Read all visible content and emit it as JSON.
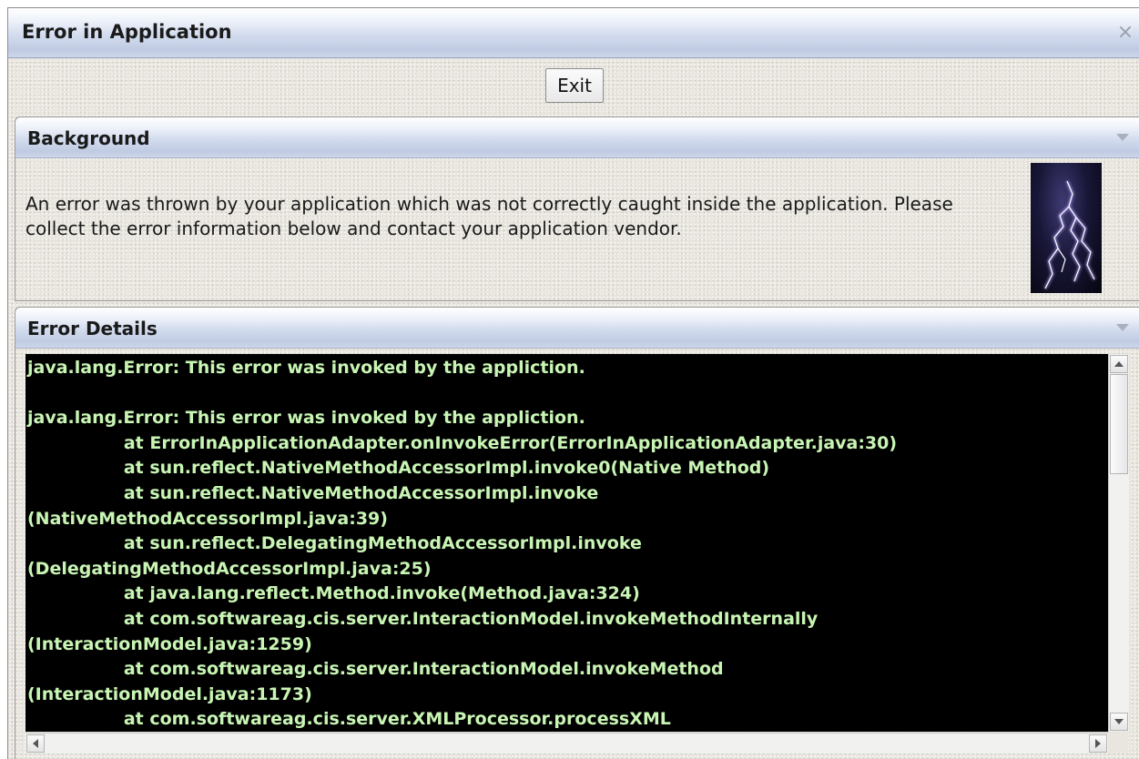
{
  "window": {
    "title": "Error in Application",
    "close_glyph": "×"
  },
  "exit_button": {
    "label": "Exit"
  },
  "background_panel": {
    "title": "Background",
    "text": "An error was thrown by your application which was not correctly caught inside the application. Please collect the error information below and contact your application vendor.",
    "image": "lightning-image"
  },
  "error_panel": {
    "title": "Error Details",
    "trace_text": "java.lang.Error: This error was invoked by the appliction.\n\njava.lang.Error: This error was invoked by the appliction.\n\t\tat ErrorInApplicationAdapter.onInvokeError(ErrorInApplicationAdapter.java:30)\n\t\tat sun.reflect.NativeMethodAccessorImpl.invoke0(Native Method)\n\t\tat sun.reflect.NativeMethodAccessorImpl.invoke\n(NativeMethodAccessorImpl.java:39)\n\t\tat sun.reflect.DelegatingMethodAccessorImpl.invoke\n(DelegatingMethodAccessorImpl.java:25)\n\t\tat java.lang.reflect.Method.invoke(Method.java:324)\n\t\tat com.softwareag.cis.server.InteractionModel.invokeMethodInternally\n(InteractionModel.java:1259)\n\t\tat com.softwareag.cis.server.InteractionModel.invokeMethod\n(InteractionModel.java:1173)\n\t\tat com.softwareag.cis.server.XMLProcessor.processXML"
  },
  "colors": {
    "console_background": "#000000",
    "console_text": "#c8f5b4",
    "header_gradient": "#bfcbe3"
  }
}
